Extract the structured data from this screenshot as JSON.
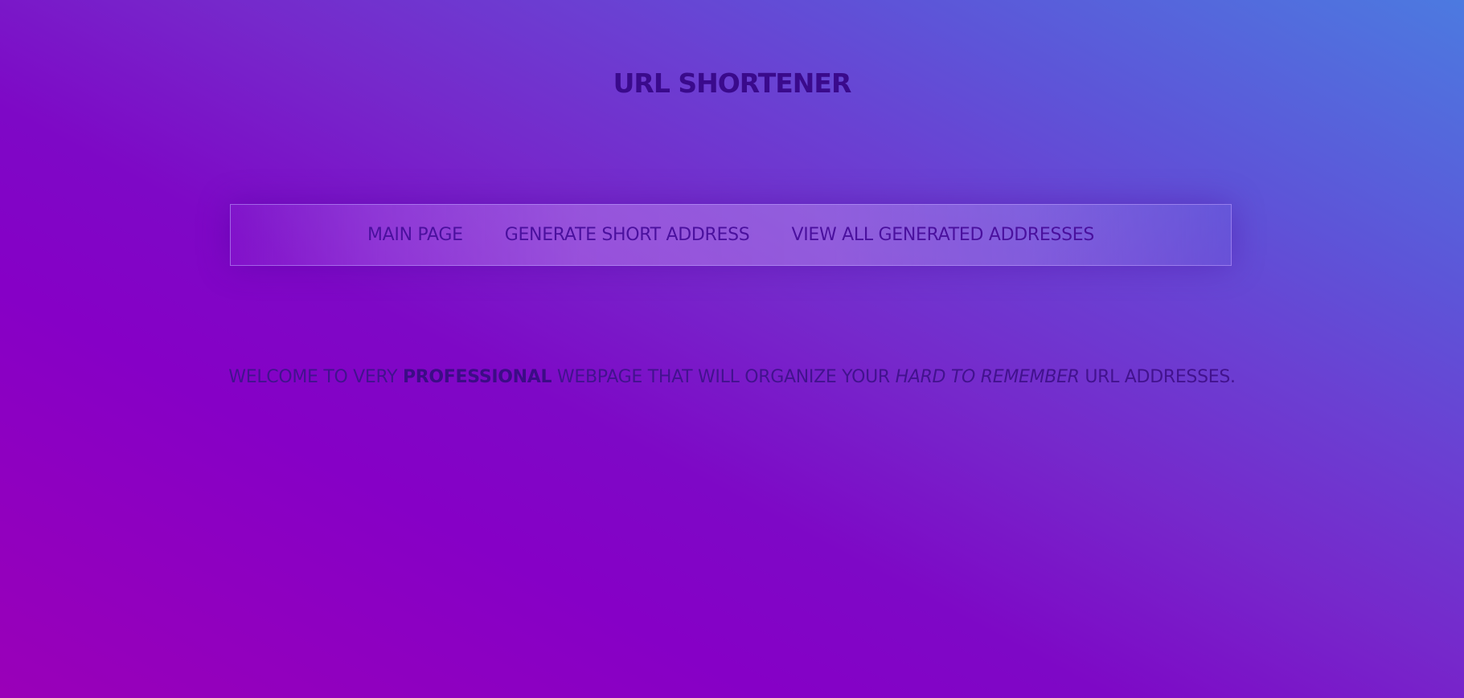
{
  "header": {
    "title": "URL SHORTENER"
  },
  "nav": {
    "items": [
      {
        "label": "MAIN PAGE"
      },
      {
        "label": "GENERATE SHORT ADDRESS"
      },
      {
        "label": "VIEW ALL GENERATED ADDRESSES"
      }
    ]
  },
  "main": {
    "welcome": {
      "part1": "WELCOME TO VERY ",
      "bold": "PROFESSIONAL",
      "part2": " WEBPAGE THAT WILL ORGANIZE YOUR ",
      "italic": "HARD TO REMEMBER",
      "part3": " URL ADDRESSES."
    }
  },
  "colors": {
    "title": "#3a0a8c",
    "nav_text": "#4a109e",
    "body_text": "#42128e",
    "gradient_start": "#9a00b8",
    "gradient_mid": "#8600c6",
    "gradient_end": "#4c7ae0"
  }
}
